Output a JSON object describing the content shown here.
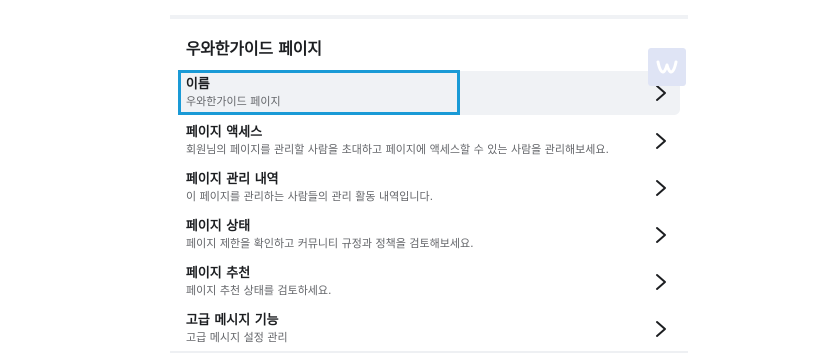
{
  "panel": {
    "title": "우와한가이드 페이지"
  },
  "settings": {
    "items": [
      {
        "title": "이름",
        "description": "우와한가이드 페이지",
        "selected": true
      },
      {
        "title": "페이지 액세스",
        "description": "회원님의 페이지를 관리할 사람을 초대하고 페이지에 액세스할 수 있는 사람을 관리해보세요.",
        "selected": false
      },
      {
        "title": "페이지 관리 내역",
        "description": "이 페이지를 관리하는 사람들의 관리 활동 내역입니다.",
        "selected": false
      },
      {
        "title": "페이지 상태",
        "description": "페이지 제한을 확인하고 커뮤니티 규정과 정책을 검토해보세요.",
        "selected": false
      },
      {
        "title": "페이지 추천",
        "description": "페이지 추천 상태를 검토하세요.",
        "selected": false
      },
      {
        "title": "고급 메시지 기능",
        "description": "고급 메시지 설정 관리",
        "selected": false
      }
    ],
    "chevron_icon": "chevron-right-icon"
  },
  "watermark": {
    "icon": "w-logo-icon",
    "color": "#ffffff"
  },
  "colors": {
    "highlight_border": "#1a9ad6",
    "selected_bg": "#f0f2f5",
    "title_text": "#1c1e21",
    "desc_text": "#65676b"
  }
}
